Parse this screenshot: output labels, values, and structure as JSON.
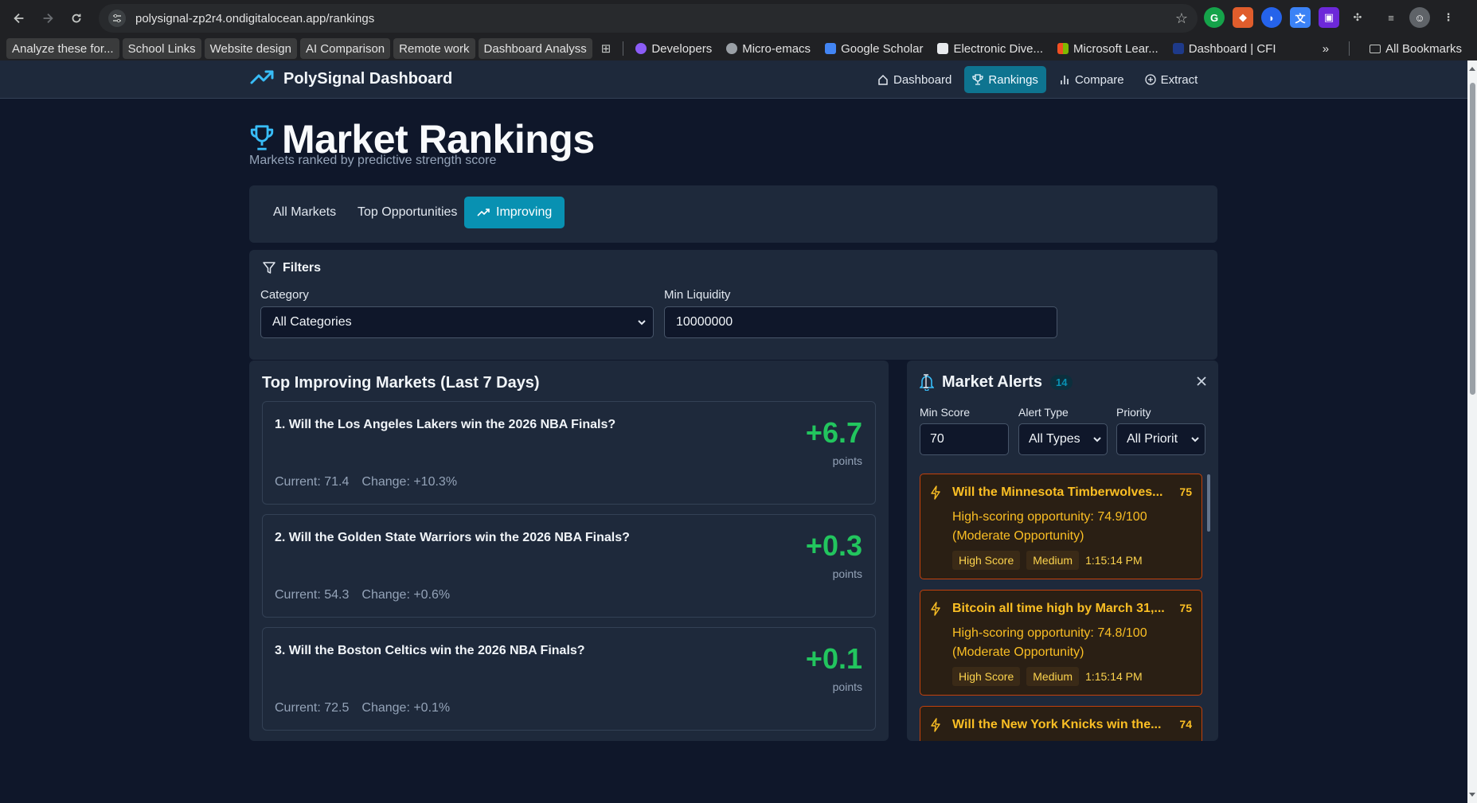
{
  "browser": {
    "url": "polysignal-zp2r4.ondigitalocean.app/rankings",
    "bookmarks": [
      {
        "label": "Analyze these for...",
        "highlight": true
      },
      {
        "label": "School Links",
        "highlight": true
      },
      {
        "label": "Website design",
        "highlight": true
      },
      {
        "label": "AI Comparison",
        "highlight": true
      },
      {
        "label": "Remote work",
        "highlight": true
      },
      {
        "label": "Dashboard Analyss",
        "highlight": true
      },
      {
        "label": "Developers"
      },
      {
        "label": "Micro-emacs"
      },
      {
        "label": "Google Scholar"
      },
      {
        "label": "Electronic Dive..."
      },
      {
        "label": "Microsoft Lear..."
      },
      {
        "label": "Dashboard | CFI"
      }
    ],
    "more": "»",
    "all_bookmarks": "All Bookmarks"
  },
  "app": {
    "brand": "PolySignal Dashboard",
    "nav": {
      "dashboard": "Dashboard",
      "rankings": "Rankings",
      "compare": "Compare",
      "extract": "Extract"
    },
    "title": "Market Rankings",
    "subtitle": "Markets ranked by predictive strength score",
    "tabs": {
      "all": "All Markets",
      "top": "Top Opportunities",
      "improving": "Improving"
    },
    "filters": {
      "heading": "Filters",
      "category_label": "Category",
      "category_value": "All Categories",
      "liquidity_label": "Min Liquidity",
      "liquidity_value": "10000000"
    },
    "improving": {
      "title": "Top Improving Markets (Last 7 Days)",
      "unit": "points",
      "items": [
        {
          "question": "1. Will the Los Angeles Lakers win the 2026 NBA Finals?",
          "delta": "+6.7",
          "current": "Current: 71.4",
          "change": "Change: +10.3%"
        },
        {
          "question": "2. Will the Golden State Warriors win the 2026 NBA Finals?",
          "delta": "+0.3",
          "current": "Current: 54.3",
          "change": "Change: +0.6%"
        },
        {
          "question": "3. Will the Boston Celtics win the 2026 NBA Finals?",
          "delta": "+0.1",
          "current": "Current: 72.5",
          "change": "Change: +0.1%"
        }
      ]
    },
    "alerts": {
      "title": "Market Alerts",
      "count": "14",
      "min_score_label": "Min Score",
      "min_score_value": "70",
      "alert_type_label": "Alert Type",
      "alert_type_value": "All Types",
      "priority_label": "Priority",
      "priority_value": "All Priorit",
      "items": [
        {
          "title": "Will the Minnesota Timberwolves...",
          "score": "75",
          "message": "High-scoring opportunity: 74.9/100 (Moderate Opportunity)",
          "tag1": "High Score",
          "tag2": "Medium",
          "time": "1:15:14 PM"
        },
        {
          "title": "Bitcoin all time high by March 31,...",
          "score": "75",
          "message": "High-scoring opportunity: 74.8/100 (Moderate Opportunity)",
          "tag1": "High Score",
          "tag2": "Medium",
          "time": "1:15:14 PM"
        },
        {
          "title": "Will the New York Knicks win the...",
          "score": "74",
          "message": "",
          "tag1": "",
          "tag2": "",
          "time": ""
        }
      ]
    }
  },
  "colors": {
    "accent": "#0891b2",
    "positive": "#22c55e",
    "alert": "#fbbf24"
  }
}
